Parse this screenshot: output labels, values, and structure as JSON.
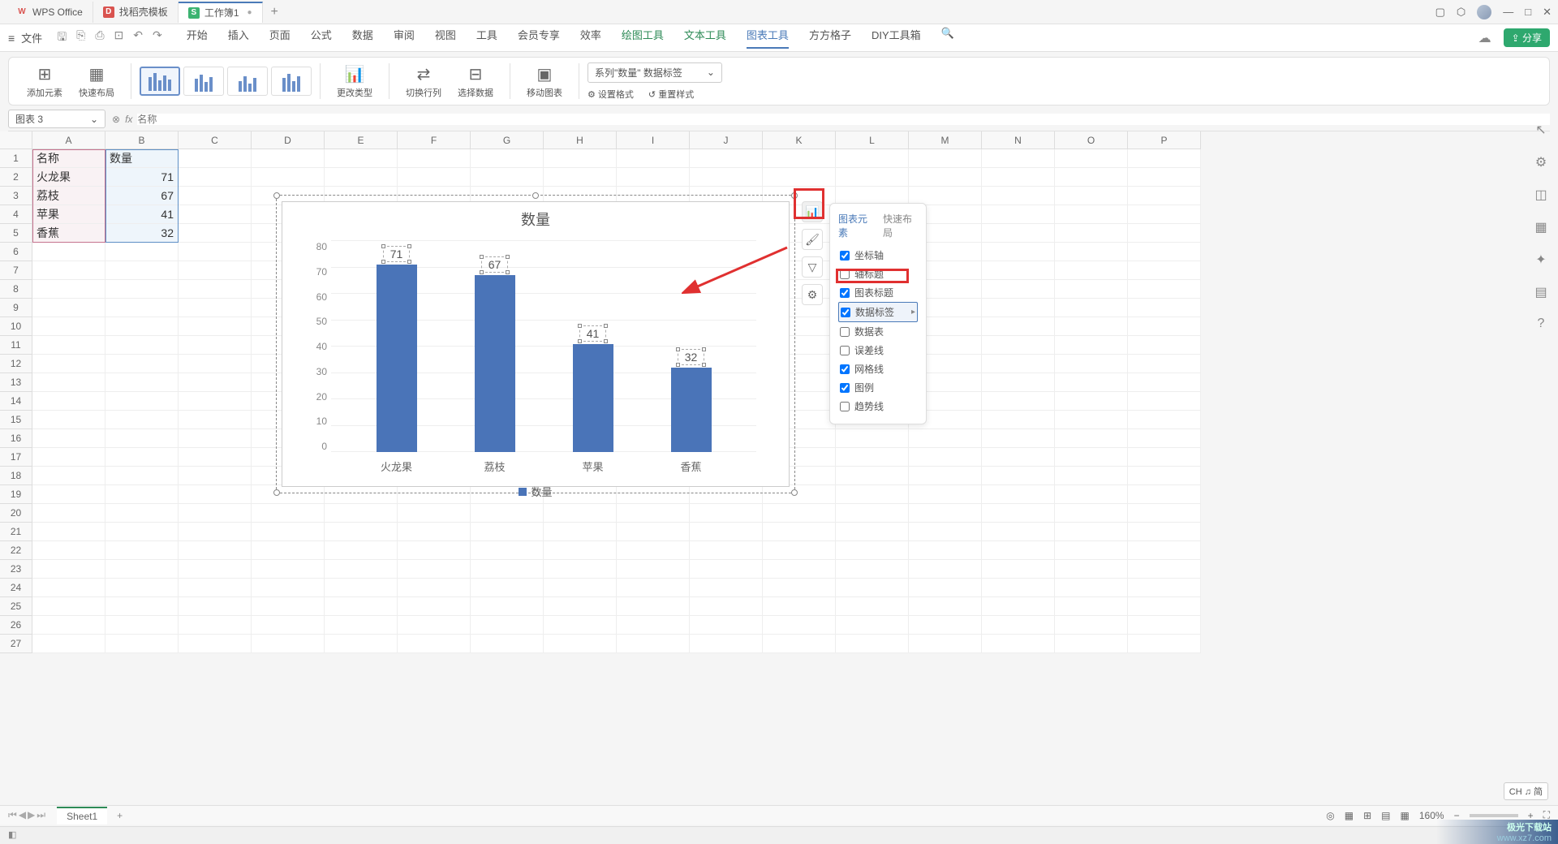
{
  "title_tabs": [
    {
      "icon": "W",
      "label": "WPS Office",
      "cls": "wps-icon"
    },
    {
      "icon": "D",
      "label": "找稻壳模板",
      "cls": "red-icon"
    },
    {
      "icon": "S",
      "label": "工作簿1",
      "cls": "green-icon",
      "active": true
    }
  ],
  "file_menu": "文件",
  "menu_tabs": {
    "items": [
      "开始",
      "插入",
      "页面",
      "公式",
      "数据",
      "审阅",
      "视图",
      "工具",
      "会员专享",
      "效率"
    ],
    "green": [
      "绘图工具",
      "文本工具"
    ],
    "active": "图表工具",
    "after": [
      "方方格子",
      "DIY工具箱"
    ]
  },
  "share_btn": "分享",
  "ribbon": {
    "add_element": "添加元素",
    "quick_layout": "快速布局",
    "change_type": "更改类型",
    "switch_rc": "切换行列",
    "select_data": "选择数据",
    "move_chart": "移动图表",
    "series_dropdown": "系列\"数量\" 数据标签",
    "set_format": "设置格式",
    "reset_style": "重置样式"
  },
  "name_box": "图表 3",
  "formula_placeholder": "名称",
  "columns": [
    "A",
    "B",
    "C",
    "D",
    "E",
    "F",
    "G",
    "H",
    "I",
    "J",
    "K",
    "L",
    "M",
    "N",
    "O",
    "P"
  ],
  "table": {
    "headers": {
      "a": "名称",
      "b": "数量"
    },
    "rows": [
      {
        "a": "火龙果",
        "b": "71"
      },
      {
        "a": "荔枝",
        "b": "67"
      },
      {
        "a": "苹果",
        "b": "41"
      },
      {
        "a": "香蕉",
        "b": "32"
      }
    ]
  },
  "chart_data": {
    "type": "bar",
    "title": "数量",
    "categories": [
      "火龙果",
      "荔枝",
      "苹果",
      "香蕉"
    ],
    "values": [
      71,
      67,
      41,
      32
    ],
    "ylim": [
      0,
      80
    ],
    "yticks": [
      0,
      10,
      20,
      30,
      40,
      50,
      60,
      70,
      80
    ],
    "legend": "数量"
  },
  "popup": {
    "tab1": "图表元素",
    "tab2": "快速布局",
    "items": [
      {
        "label": "坐标轴",
        "checked": true
      },
      {
        "label": "轴标题",
        "checked": false
      },
      {
        "label": "图表标题",
        "checked": true
      },
      {
        "label": "数据标签",
        "checked": true,
        "highlighted": true,
        "arrow": true
      },
      {
        "label": "数据表",
        "checked": false
      },
      {
        "label": "误差线",
        "checked": false
      },
      {
        "label": "网格线",
        "checked": true
      },
      {
        "label": "图例",
        "checked": true
      },
      {
        "label": "趋势线",
        "checked": false
      }
    ]
  },
  "sheet_tab": "Sheet1",
  "zoom": "160%",
  "ime": "CH ♫ 简",
  "watermark_main": "极光下载站",
  "watermark_sub": "www.xz7.com"
}
